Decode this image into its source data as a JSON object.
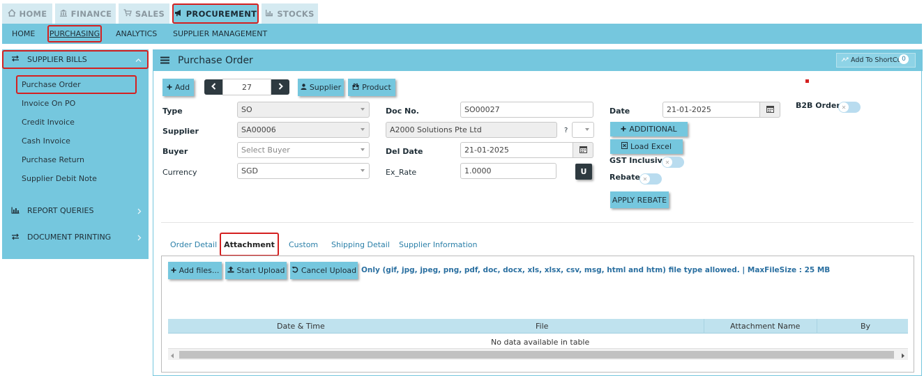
{
  "top_tabs": [
    {
      "label": "HOME",
      "icon": "home-icon"
    },
    {
      "label": "FINANCE",
      "icon": "bank-icon"
    },
    {
      "label": "SALES",
      "icon": "cart-icon"
    },
    {
      "label": "PROCUREMENT",
      "icon": "megaphone-icon"
    },
    {
      "label": "STOCKS",
      "icon": "bar-chart-icon"
    }
  ],
  "sub_nav": [
    "HOME",
    "PURCHASING",
    "ANALYTICS",
    "SUPPLIER MANAGEMENT"
  ],
  "sidebar": {
    "supplier_bills": "SUPPLIER BILLS",
    "items": [
      "Purchase Order",
      "Invoice On PO",
      "Credit Invoice",
      "Cash Invoice",
      "Purchase Return",
      "Supplier Debit Note"
    ],
    "report_queries": "REPORT QUERIES",
    "document_printing": "DOCUMENT PRINTING"
  },
  "header": {
    "title": "Purchase Order",
    "shortcut": "Add To ShortCut",
    "shortcut_count": "0"
  },
  "toolbar": {
    "add": "Add",
    "record_no": "27",
    "supplier": "Supplier",
    "product": "Product"
  },
  "form": {
    "type_label": "Type",
    "type_value": "SO",
    "supplier_label": "Supplier",
    "supplier_value": "SA00006",
    "buyer_label": "Buyer",
    "buyer_placeholder": "Select Buyer",
    "currency_label": "Currency",
    "currency_value": "SGD",
    "docno_label": "Doc No.",
    "docno_value": "SO00027",
    "supplier_name": "A2000 Solutions Pte Ltd",
    "question": "?",
    "deldate_label": "Del Date",
    "deldate_value": "21-01-2025",
    "exrate_label": "Ex_Rate",
    "exrate_value": "1.0000",
    "u_button": "U",
    "date_label": "Date",
    "date_value": "21-01-2025",
    "additional": "ADDITIONAL",
    "load_excel": "Load Excel",
    "gst_label": "GST Inclusive",
    "rebate_label": "Rebate",
    "apply_rebate": "APPLY REBATE",
    "b2b_label": "B2B Order"
  },
  "tabs": [
    "Order Detail",
    "Attachment",
    "Custom",
    "Shipping Detail",
    "Supplier Information"
  ],
  "upload": {
    "add_files": "Add files...",
    "start_upload": "Start Upload",
    "cancel_upload": "Cancel Upload",
    "note": "Only (gif, jpg, jpeg, png, pdf, doc, docx, xls, xlsx, csv, msg, html and htm) file type allowed. | MaxFileSize : 25 MB"
  },
  "table": {
    "columns": [
      "Date & Time",
      "File",
      "Attachment Name",
      "By"
    ],
    "empty": "No data available in table"
  },
  "colors": {
    "accent": "#75c7de",
    "red_highlight": "#d42020",
    "link": "#2a7fa8"
  }
}
